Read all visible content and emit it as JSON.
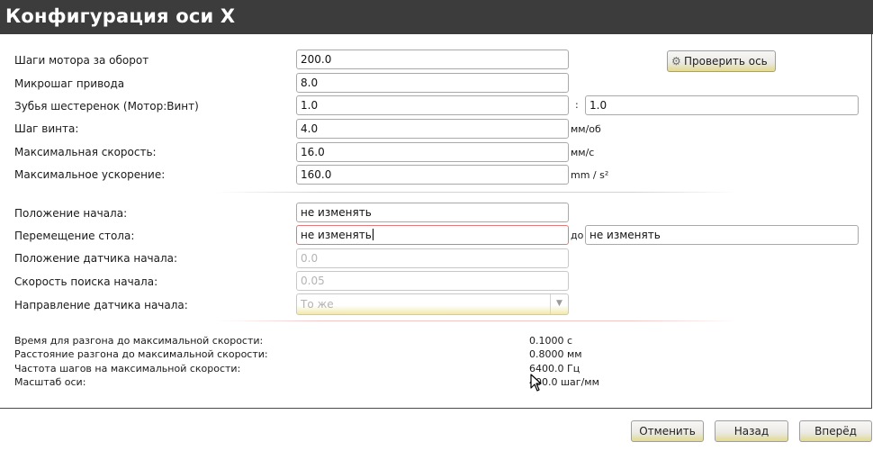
{
  "window": {
    "title": "Конфигурация оси X"
  },
  "motor": {
    "steps_label": "Шаги мотора за оборот",
    "steps_value": "200.0",
    "microstep_label": "Микрошаг привода",
    "microstep_value": "8.0",
    "gears_label": "Зубья шестеренок (Мотор:Винт)",
    "gear_motor_value": "1.0",
    "gear_sep": ":",
    "gear_screw_value": "1.0",
    "pitch_label": "Шаг винта:",
    "pitch_value": "4.0",
    "pitch_unit": "мм/об",
    "maxvel_label": "Максимальная скорость:",
    "maxvel_value": "16.0",
    "maxvel_unit": "мм/с",
    "maxaccel_label": "Максимальное ускорение:",
    "maxaccel_value": "160.0",
    "maxaccel_unit": "mm / s²",
    "test_axis_label": "Проверить ось"
  },
  "homing": {
    "home_pos_label": "Положение начала:",
    "home_pos_value": "не изменять",
    "travel_label": "Перемещение стола:",
    "travel_min_value": "не изменять",
    "travel_to": "до",
    "travel_max_value": "не изменять",
    "home_switch_label": "Положение датчика начала:",
    "home_switch_value": "0.0",
    "search_vel_label": "Скорость поиска начала:",
    "search_vel_value": "0.05",
    "home_dir_label": "Направление датчика начала:",
    "home_dir_value": "То же"
  },
  "info": {
    "accel_time_label": "Время для разгона до максимальной скорости:",
    "accel_time_value": "0.1000 с",
    "accel_dist_label": "Расстояние разгона до максимальной скорости:",
    "accel_dist_value": "0.8000 мм",
    "step_rate_label": "Частота шагов на максимальной скорости:",
    "step_rate_value": "6400.0 Гц",
    "scale_label": "Масштаб оси:",
    "scale_value": "400.0 шаг/мм"
  },
  "nav": {
    "cancel_label": "Отменить",
    "back_label": "Назад",
    "forward_label": "Вперёд"
  },
  "icons": {
    "test_axis": "gears-icon",
    "cursor": "mouse-pointer-icon"
  }
}
